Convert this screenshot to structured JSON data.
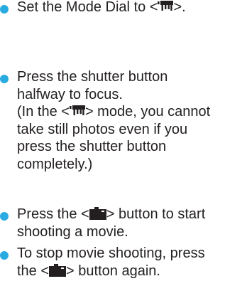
{
  "colors": {
    "bullet": "#29abe2",
    "text": "#231f20"
  },
  "icons": {
    "movie_mode": "movie-camera-icon",
    "start_stop": "live-view-shooting-button-icon"
  },
  "steps": [
    {
      "lines": [
        {
          "before": "Set the Mode Dial to <",
          "icon": "movie_mode",
          "after": ">."
        }
      ]
    },
    {
      "lines": [
        {
          "before": "Press the shutter button"
        },
        {
          "before": "halfway to focus."
        },
        {
          "before": "(In the <",
          "icon": "movie_mode",
          "after": "> mode, you cannot"
        },
        {
          "before": "take still photos even if you"
        },
        {
          "before": "press the shutter button"
        },
        {
          "before": "completely.)"
        }
      ]
    },
    {
      "lines": [
        {
          "before": "Press the <",
          "icon": "start_stop",
          "after": "> button to start"
        },
        {
          "before": "shooting a movie."
        }
      ]
    },
    {
      "lines": [
        {
          "before": "To stop movie shooting, press"
        },
        {
          "before": "the <",
          "icon": "start_stop",
          "after": "> button again."
        }
      ]
    }
  ]
}
